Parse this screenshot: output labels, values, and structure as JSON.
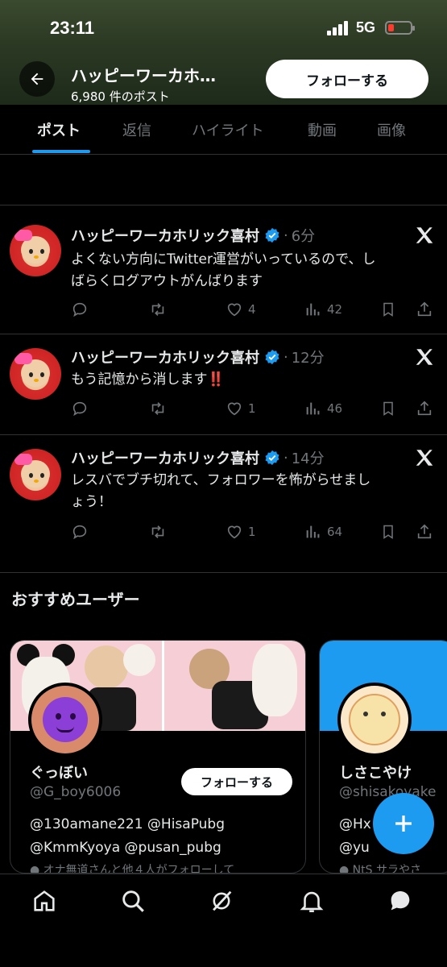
{
  "status_bar": {
    "time": "23:11",
    "network": "5G"
  },
  "header": {
    "title": "ハッピーワーカホ…",
    "post_count": "6,980 件のポスト",
    "follow_label": "フォローする"
  },
  "tabs": [
    {
      "label": "ポスト"
    },
    {
      "label": "返信"
    },
    {
      "label": "ハイライト"
    },
    {
      "label": "動画"
    },
    {
      "label": "画像"
    }
  ],
  "posts": [
    {
      "author": "ハッピーワーカホリック喜村",
      "time": "6分",
      "text_line1": "よくない方向にTwitter運営がいっているので、し",
      "text_line2": "ばらくログアウトがんばります",
      "likes": "4",
      "views": "42"
    },
    {
      "author": "ハッピーワーカホリック喜村",
      "time": "12分",
      "text_line1": "もう記憶から消します‼️",
      "text_line2": "",
      "likes": "1",
      "views": "46"
    },
    {
      "author": "ハッピーワーカホリック喜村",
      "time": "14分",
      "text_line1": "レスバでブチ切れて、フォロワーを怖がらせまし",
      "text_line2": "ょう！",
      "likes": "1",
      "views": "64"
    }
  ],
  "recommended": {
    "title": "おすすめユーザー",
    "cards": [
      {
        "name": "ぐっぼい",
        "handle": "@G_boy6006",
        "follow_label": "フォローする",
        "bio_line1": "@130amane221 @HisaPubg",
        "bio_line2": "@KmmKyoya @pusan_pubg",
        "footer": "オナ無道さんと他４人がフォローして"
      },
      {
        "name": "しさこやけ",
        "handle": "@shisakoyake",
        "bio_line1": "@Hx",
        "bio_line2": "@yu",
        "footer": "NtS サラやさ"
      }
    ]
  },
  "colors": {
    "accent": "#1d9bf0",
    "background": "#000000",
    "muted": "#71767b",
    "text": "#e7e9ea"
  },
  "icons": [
    "back-arrow-icon",
    "verified-badge-icon",
    "x-logo-icon",
    "reply-icon",
    "repost-icon",
    "like-icon",
    "views-icon",
    "bookmark-icon",
    "share-icon",
    "compose-icon",
    "home-icon",
    "search-icon",
    "grok-icon",
    "notifications-icon",
    "messages-icon"
  ]
}
